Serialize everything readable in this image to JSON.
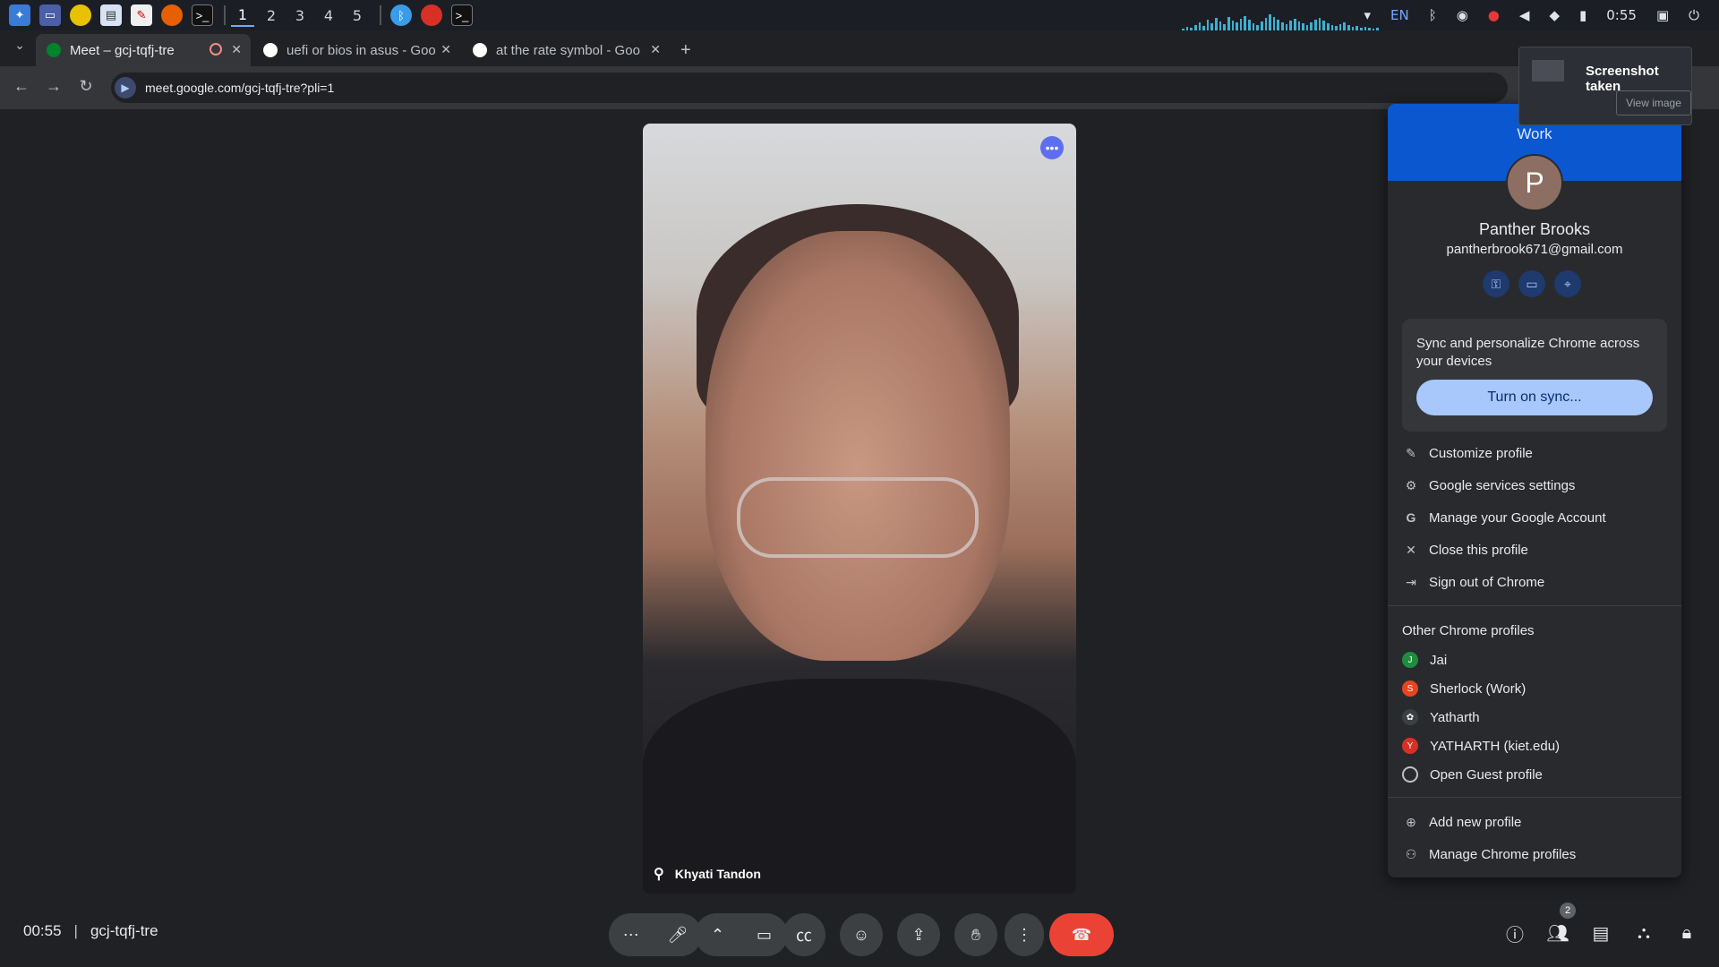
{
  "taskbar": {
    "workspaces": [
      "1",
      "2",
      "3",
      "4",
      "5"
    ],
    "keyboard_layout": "EN",
    "clock": "0:55"
  },
  "tabs": [
    {
      "title": "Meet – gcj-tqfj-tre",
      "close": "✕"
    },
    {
      "title": "uefi or bios in asus - Goo",
      "close": "✕"
    },
    {
      "title": "at the rate symbol - Goo",
      "close": "✕"
    }
  ],
  "new_tab": "+",
  "address": {
    "url": "meet.google.com/gcj-tqfj-tre?pli=1"
  },
  "meeting": {
    "time": "00:55",
    "divider": "|",
    "code": "gcj-tqfj-tre",
    "participant_name": "Khyati Tandon",
    "people_count": "2"
  },
  "profile_menu": {
    "header": "Work",
    "avatar_letter": "P",
    "name": "Panther Brooks",
    "email": "pantherbrook671@gmail.com",
    "sync_text": "Sync and personalize Chrome across your devices",
    "sync_button": "Turn on sync...",
    "items": [
      {
        "label": "Customize profile",
        "icon": "pencil-icon"
      },
      {
        "label": "Google services settings",
        "icon": "gear-icon"
      },
      {
        "label": "Manage your Google Account",
        "icon": "google-g-icon"
      },
      {
        "label": "Close this profile",
        "icon": "close-icon"
      },
      {
        "label": "Sign out of Chrome",
        "icon": "sign-out-icon"
      }
    ],
    "other_profiles_title": "Other Chrome profiles",
    "other_profiles": [
      {
        "label": "Jai",
        "initial": "J",
        "color": "#1e8e3e"
      },
      {
        "label": "Sherlock (Work)",
        "initial": "S",
        "color": "#e8441f"
      },
      {
        "label": "Yatharth",
        "initial": "",
        "color": "#3c4043"
      },
      {
        "label": "YATHARTH (kiet.edu)",
        "initial": "Y",
        "color": "#d93025"
      },
      {
        "label": "Open Guest profile",
        "initial": "",
        "color": "#3c4043"
      }
    ],
    "footer_items": [
      {
        "label": "Add new profile",
        "icon": "add-person-icon"
      },
      {
        "label": "Manage Chrome profiles",
        "icon": "people-icon"
      }
    ]
  },
  "notification": {
    "title": "Screenshot taken",
    "action": "View image"
  },
  "colors": {
    "accent": "#0b57d0",
    "end_call": "#ea4335",
    "tile_menu": "#5d6ef0"
  }
}
